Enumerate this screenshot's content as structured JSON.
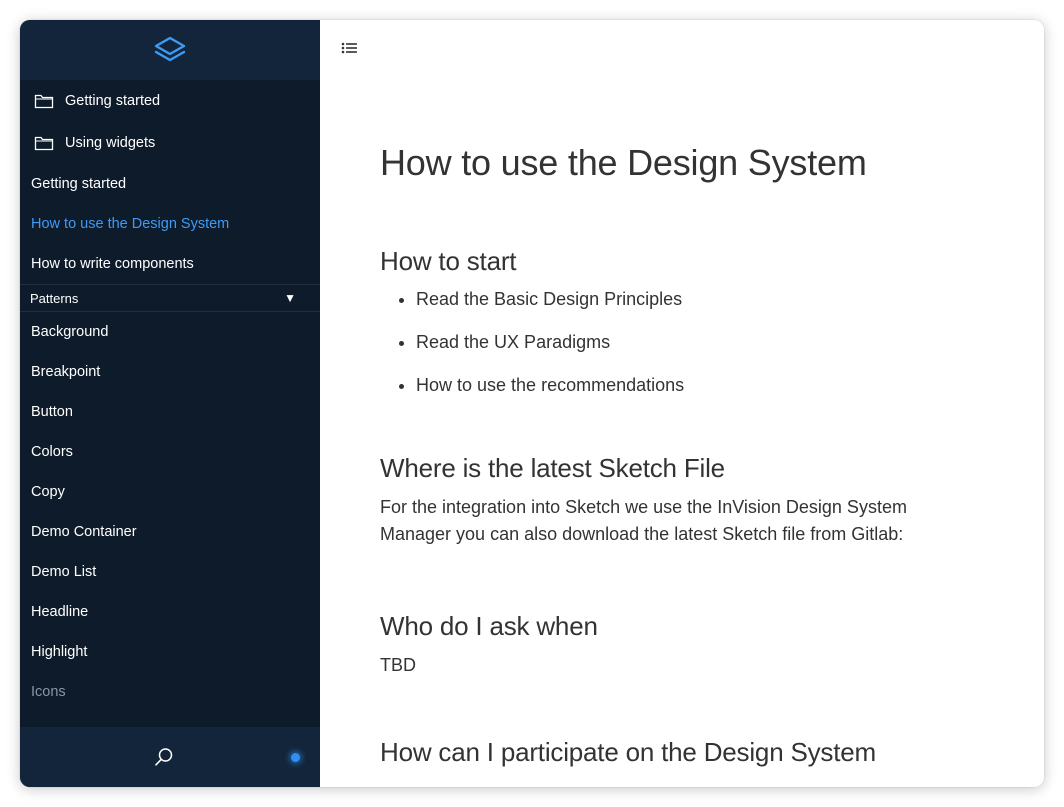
{
  "sidebar": {
    "logo_icon": "layers-icon",
    "folders": [
      {
        "label": "Getting started",
        "icon": "folder-icon"
      },
      {
        "label": "Using widgets",
        "icon": "folder-icon"
      }
    ],
    "links": [
      {
        "label": "Getting started",
        "active": false
      },
      {
        "label": "How to use the Design System",
        "active": true
      },
      {
        "label": "How to write components",
        "active": false
      }
    ],
    "section": {
      "label": "Patterns",
      "toggle": "▼",
      "items": [
        "Background",
        "Breakpoint",
        "Button",
        "Colors",
        "Copy",
        "Demo Container",
        "Demo List",
        "Headline",
        "Highlight",
        "Icons"
      ]
    },
    "footer": {
      "search_icon": "search-icon",
      "status_color": "#2f8ff0"
    }
  },
  "main": {
    "toc_icon": "list-icon",
    "title": "How to use the Design System",
    "sections": {
      "start": {
        "heading": "How to start",
        "items": [
          "Read the Basic Design Principles",
          "Read the UX Paradigms",
          "How to use the recommendations"
        ]
      },
      "sketch": {
        "heading": "Where is the latest Sketch File",
        "body_line1": "For the integration into Sketch we use the InVision Design System",
        "body_line2": "Manager you can also download the latest Sketch file from Gitlab:"
      },
      "ask": {
        "heading": "Who do I ask when",
        "body": "TBD"
      },
      "participate": {
        "heading": "How can I participate on the Design System"
      }
    }
  },
  "colors": {
    "sidebar_bg": "#0e1b2a",
    "sidebar_header_bg": "#13253a",
    "accent": "#3d9bf5",
    "text_main": "#333333"
  }
}
